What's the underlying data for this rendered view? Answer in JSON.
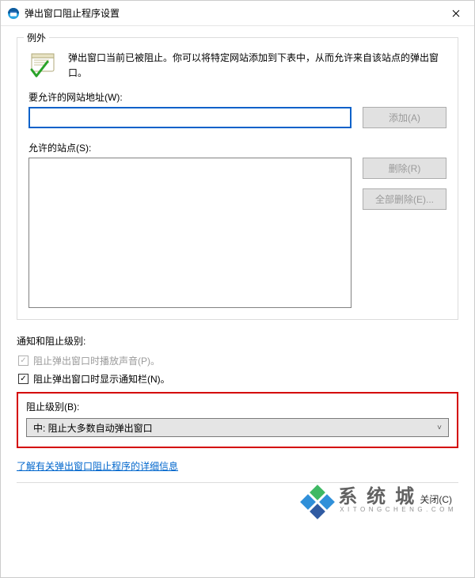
{
  "titlebar": {
    "title": "弹出窗口阻止程序设置"
  },
  "exceptions": {
    "group_label": "例外",
    "intro": "弹出窗口当前已被阻止。你可以将特定网站添加到下表中，从而允许来自该站点的弹出窗口。",
    "address_label": "要允许的网站地址(W):",
    "add_btn": "添加(A)",
    "allowed_label": "允许的站点(S):",
    "remove_btn": "删除(R)",
    "remove_all_btn": "全部删除(E)..."
  },
  "notify": {
    "title": "通知和阻止级别:",
    "play_sound": "阻止弹出窗口时播放声音(P)。",
    "show_bar": "阻止弹出窗口时显示通知栏(N)。"
  },
  "level": {
    "label": "阻止级别(B):",
    "value": "中: 阻止大多数自动弹出窗口"
  },
  "link_text": "了解有关弹出窗口阻止程序的详细信息",
  "close_label": "关闭(C)",
  "watermark": {
    "main": "系统城",
    "sub": "XITONGCHENG.COM"
  }
}
